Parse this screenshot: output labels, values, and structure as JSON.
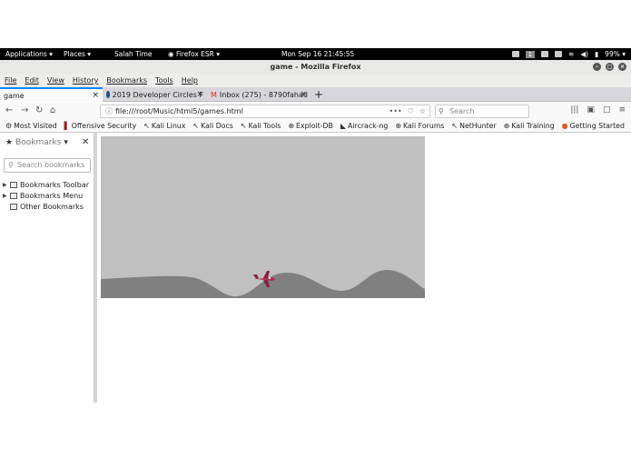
{
  "panel": {
    "applications": "Applications ▾",
    "places": "Places ▾",
    "salah_time": "Salah Time",
    "firefox_menu": "Firefox ESR ▾",
    "clock": "Mon Sep 16  21:45:55",
    "workspace": "1",
    "battery": "99% ▾"
  },
  "window": {
    "title": "game - Mozilla Firefox"
  },
  "menubar": [
    "File",
    "Edit",
    "View",
    "History",
    "Bookmarks",
    "Tools",
    "Help"
  ],
  "tabs": [
    {
      "label": "game",
      "active": true
    },
    {
      "label": "2019 Developer Circles F",
      "active": false
    },
    {
      "label": "Inbox (275) - 8790fahad",
      "active": false
    }
  ],
  "navbar": {
    "url": "file:///root/Music/html5/games.html",
    "search_placeholder": "Search"
  },
  "bookmarks_toolbar": [
    {
      "label": "Most Visited",
      "icon": "gear-icon"
    },
    {
      "label": "Offensive Security",
      "icon": "offsec-icon"
    },
    {
      "label": "Kali Linux",
      "icon": "kali-icon"
    },
    {
      "label": "Kali Docs",
      "icon": "kali-icon"
    },
    {
      "label": "Kali Tools",
      "icon": "kali-icon"
    },
    {
      "label": "Exploit-DB",
      "icon": "globe-icon"
    },
    {
      "label": "Aircrack-ng",
      "icon": "aircrack-icon"
    },
    {
      "label": "Kali Forums",
      "icon": "globe-icon"
    },
    {
      "label": "NetHunter",
      "icon": "kali-icon"
    },
    {
      "label": "Kali Training",
      "icon": "globe-icon"
    },
    {
      "label": "Getting Started",
      "icon": "firefox-icon"
    }
  ],
  "sidebar": {
    "title": "Bookmarks",
    "search_placeholder": "Search bookmarks",
    "items": [
      {
        "label": "Bookmarks Toolbar",
        "expandable": true
      },
      {
        "label": "Bookmarks Menu",
        "expandable": true
      },
      {
        "label": "Other Bookmarks",
        "expandable": false
      }
    ]
  },
  "colors": {
    "panel_bg": "#000000",
    "game_sky": "#c0c0c0",
    "game_ground": "#808080",
    "plane": "#b03050",
    "tab_accent": "#0a84ff"
  }
}
